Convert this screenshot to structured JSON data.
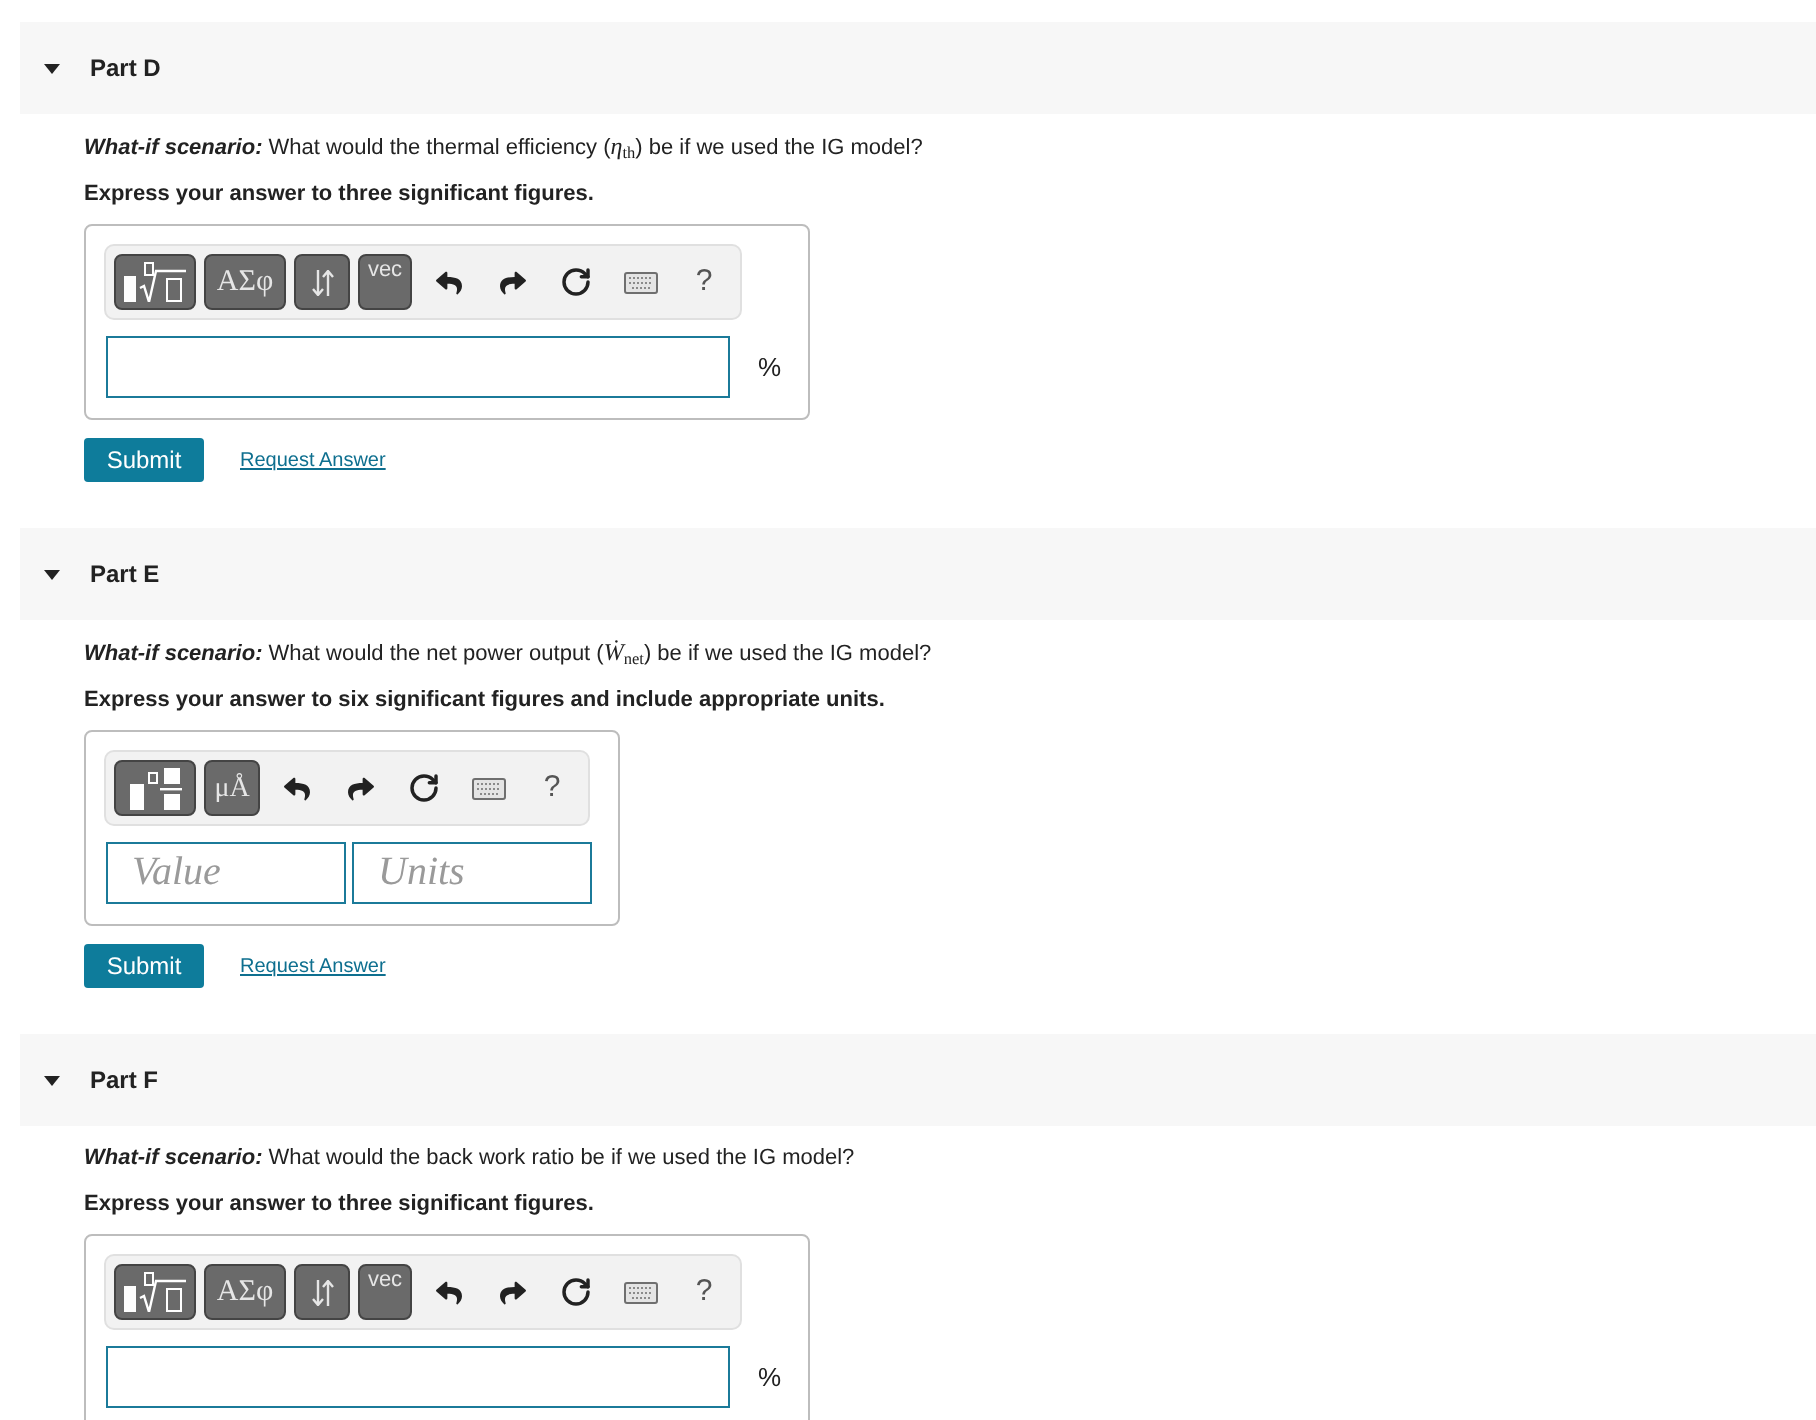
{
  "parts": [
    {
      "title": "Part D",
      "expanded": true,
      "question": "**What-if scenario:** What would the thermal efficiency (*η*$_{th}$) be if we used the IG model?",
      "instruction": "Express your answer to three significant figures.",
      "toolbar": [
        {
          "kind": "root-template"
        },
        {
          "kind": "greek",
          "label": "ΑΣφ"
        },
        {
          "kind": "arrows"
        },
        {
          "kind": "vector",
          "label": "vec"
        },
        {
          "kind": "undo"
        },
        {
          "kind": "redo"
        },
        {
          "kind": "reset"
        },
        {
          "kind": "keyboard"
        },
        {
          "kind": "help",
          "label": "?"
        }
      ],
      "fields": [
        {
          "kind": "wide"
        }
      ],
      "unit": "%",
      "submit": "Submit",
      "request": "Request Answer"
    },
    {
      "title": "Part E",
      "expanded": true,
      "question": "**What-if scenario:** What would the net power output (*Ẇ*$_{net}$) be if we used the IG model?",
      "instruction": "Express your answer to six significant figures and include appropriate units.",
      "toolbar": [
        {
          "kind": "fraction-template"
        },
        {
          "kind": "units",
          "label": "μÅ"
        },
        {
          "kind": "undo"
        },
        {
          "kind": "redo"
        },
        {
          "kind": "reset"
        },
        {
          "kind": "keyboard"
        },
        {
          "kind": "help",
          "label": "?"
        }
      ],
      "fields": [
        {
          "kind": "narrow",
          "placeholder": "Value"
        },
        {
          "kind": "narrow",
          "placeholder": "Units"
        }
      ],
      "submit": "Submit",
      "request": "Request Answer"
    },
    {
      "title": "Part F",
      "expanded": true,
      "question": "**What-if scenario:** What would the back work ratio be if we used the IG model?",
      "instruction": "Express your answer to three significant figures.",
      "toolbar": [
        {
          "kind": "root-template"
        },
        {
          "kind": "greek",
          "label": "ΑΣφ"
        },
        {
          "kind": "arrows"
        },
        {
          "kind": "vector",
          "label": "vec"
        },
        {
          "kind": "undo"
        },
        {
          "kind": "redo"
        },
        {
          "kind": "reset"
        },
        {
          "kind": "keyboard"
        },
        {
          "kind": "help",
          "label": "?"
        }
      ],
      "fields": [
        {
          "kind": "wide"
        }
      ],
      "unit": "%"
    }
  ]
}
